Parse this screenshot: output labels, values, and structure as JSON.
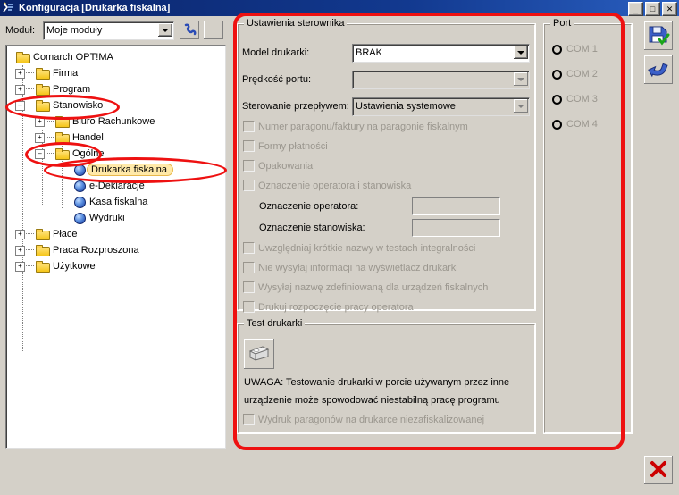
{
  "window": {
    "title": "Konfiguracja [Drukarka fiskalna]",
    "icon": "app-icon",
    "minimize": "_",
    "maximize": "□",
    "close": "✕"
  },
  "toolbar": {
    "module_label": "Moduł:",
    "module_value": "Moje moduły",
    "phone_button": "phone-icon",
    "second_button": "blank-icon"
  },
  "tree": {
    "root": "Comarch OPT!MA",
    "items": [
      {
        "label": "Firma",
        "level": 1,
        "expander": "+",
        "icon": "folder-icon"
      },
      {
        "label": "Program",
        "level": 1,
        "expander": "+",
        "icon": "folder-icon"
      },
      {
        "label": "Stanowisko",
        "level": 1,
        "expander": "–",
        "icon": "folder-icon"
      },
      {
        "label": "Biuro Rachunkowe",
        "level": 2,
        "expander": "+",
        "icon": "folder-icon"
      },
      {
        "label": "Handel",
        "level": 2,
        "expander": "+",
        "icon": "folder-icon"
      },
      {
        "label": "Ogólne",
        "level": 2,
        "expander": "–",
        "icon": "folder-icon"
      },
      {
        "label": "Drukarka fiskalna",
        "level": 3,
        "expander": "",
        "icon": "item-icon",
        "selected": true
      },
      {
        "label": "e-Deklaracje",
        "level": 3,
        "expander": "",
        "icon": "item-icon"
      },
      {
        "label": "Kasa fiskalna",
        "level": 3,
        "expander": "",
        "icon": "item-icon"
      },
      {
        "label": "Wydruki",
        "level": 3,
        "expander": "",
        "icon": "item-icon"
      },
      {
        "label": "Płace",
        "level": 1,
        "expander": "+",
        "icon": "folder-icon"
      },
      {
        "label": "Praca Rozproszona",
        "level": 1,
        "expander": "+",
        "icon": "folder-icon"
      },
      {
        "label": "Użytkowe",
        "level": 1,
        "expander": "+",
        "icon": "folder-icon"
      }
    ]
  },
  "driver_settings": {
    "title": "Ustawienia sterownika",
    "model_label": "Model drukarki:",
    "model_value": "BRAK",
    "port_speed_label": "Prędkość portu:",
    "port_speed_value": "",
    "flow_label": "Sterowanie przepływem:",
    "flow_value": "Ustawienia systemowe",
    "checkboxes": [
      "Numer paragonu/faktury na paragonie fiskalnym",
      "Formy płatności",
      "Opakowania",
      "Oznaczenie operatora i stanowiska"
    ],
    "operator_label": "Oznaczenie operatora:",
    "operator_value": "",
    "station_label": "Oznaczenie stanowiska:",
    "station_value": "",
    "checkboxes2": [
      "Uwzględniaj krótkie nazwy w testach integralności",
      "Nie wysyłaj informacji na wyświetlacz drukarki",
      "Wysyłaj nazwę zdefiniowaną dla urządzeń fiskalnych",
      "Drukuj rozpoczęcie pracy operatora"
    ]
  },
  "printer_test": {
    "title": "Test drukarki",
    "test_button": "printer-icon",
    "warning_line1": "UWAGA: Testowanie drukarki w porcie używanym przez inne",
    "warning_line2": "urządzenie może spowodować niestabilną pracę programu",
    "checkbox": "Wydruk paragonów na drukarce niezafiskalizowanej"
  },
  "port": {
    "title": "Port",
    "options": [
      "COM 1",
      "COM 2",
      "COM 3",
      "COM 4"
    ],
    "selected": ""
  },
  "side_buttons": {
    "save": "save-icon",
    "undo": "undo-icon",
    "close": "close-x-icon"
  },
  "annotation_color": "#ee1111"
}
